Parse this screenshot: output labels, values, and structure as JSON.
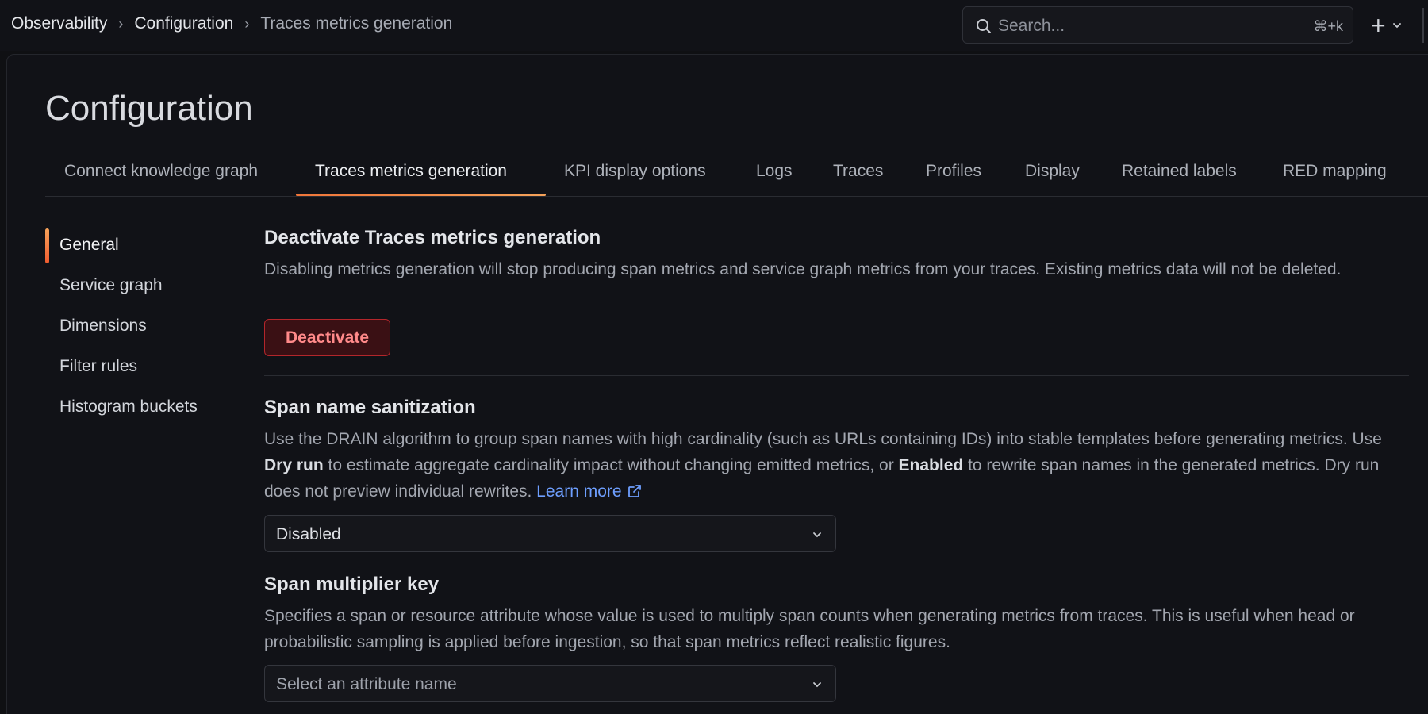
{
  "breadcrumb": [
    "Observability",
    "Configuration",
    "Traces metrics generation"
  ],
  "search": {
    "placeholder": "Search...",
    "shortcut": "⌘+k"
  },
  "header": {
    "add_icon": "plus-icon",
    "add_menu_icon": "chevron-down-icon"
  },
  "page_title": "Configuration",
  "tabs": [
    "Connect knowledge graph",
    "Traces metrics generation",
    "KPI display options",
    "Logs",
    "Traces",
    "Profiles",
    "Display",
    "Retained labels",
    "RED mapping"
  ],
  "active_tab": "Traces metrics generation",
  "sidenav": {
    "items": [
      "General",
      "Service graph",
      "Dimensions",
      "Filter rules",
      "Histogram buckets"
    ],
    "active": "General"
  },
  "deactivate_section": {
    "title": "Deactivate Traces metrics generation",
    "description": "Disabling metrics generation will stop producing span metrics and service graph metrics from your traces. Existing metrics data will not be deleted.",
    "button_label": "Deactivate"
  },
  "sanitization_section": {
    "title": "Span name sanitization",
    "desc_part1": "Use the DRAIN algorithm to group span names with high cardinality (such as URLs containing IDs) into stable templates before generating metrics. Use ",
    "desc_bold1": "Dry run",
    "desc_part2": " to estimate aggregate cardinality impact without changing emitted metrics, or ",
    "desc_bold2": "Enabled",
    "desc_part3": " to rewrite span names in the generated metrics. Dry run does not preview individual rewrites. ",
    "learn_more": "Learn more",
    "select_value": "Disabled"
  },
  "multiplier_section": {
    "title": "Span multiplier key",
    "description": "Specifies a span or resource attribute whose value is used to multiply span counts when generating metrics from traces. This is useful when head or probabilistic sampling is applied before ingestion, so that span metrics reflect realistic figures.",
    "select_placeholder": "Select an attribute name"
  },
  "colors": {
    "accent": "#f0763a",
    "danger_text": "#ff8a8a",
    "danger_border": "#b3262b",
    "link": "#6e9fff"
  }
}
